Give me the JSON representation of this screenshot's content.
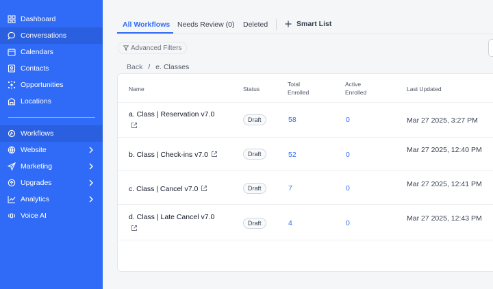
{
  "sidebar": {
    "top_items": [
      {
        "label": "Dashboard",
        "icon": "dashboard-icon"
      },
      {
        "label": "Conversations",
        "icon": "chat-icon"
      },
      {
        "label": "Calendars",
        "icon": "calendar-icon"
      },
      {
        "label": "Contacts",
        "icon": "contacts-icon"
      },
      {
        "label": "Opportunities",
        "icon": "opportunities-icon"
      },
      {
        "label": "Locations",
        "icon": "building-icon"
      }
    ],
    "bottom_items": [
      {
        "label": "Workflows",
        "icon": "workflow-icon"
      },
      {
        "label": "Website",
        "icon": "globe-icon"
      },
      {
        "label": "Marketing",
        "icon": "send-icon"
      },
      {
        "label": "Upgrades",
        "icon": "upgrade-icon"
      },
      {
        "label": "Analytics",
        "icon": "chart-icon"
      },
      {
        "label": "Voice AI",
        "icon": "voice-icon"
      }
    ]
  },
  "tabs": {
    "all": "All Workflows",
    "review": "Needs Review (0)",
    "deleted": "Deleted",
    "smart_list": "Smart List"
  },
  "filters": {
    "label": "Advanced Filters"
  },
  "breadcrumb": {
    "back": "Back",
    "separator": "/",
    "current": "e. Classes"
  },
  "table": {
    "headers": {
      "name": "Name",
      "status": "Status",
      "total_1": "Total",
      "total_2": "Enrolled",
      "active_1": "Active",
      "active_2": "Enrolled",
      "updated": "Last Updated"
    },
    "rows": [
      {
        "name": "a. Class | Reservation v7.0",
        "status": "Draft",
        "total": "58",
        "active": "0",
        "updated": "Mar 27 2025, 3:27 PM"
      },
      {
        "name": "b. Class | Check-ins v7.0",
        "status": "Draft",
        "total": "52",
        "active": "0",
        "updated": "Mar 27 2025, 12:40 PM"
      },
      {
        "name": "c. Class | Cancel v7.0",
        "status": "Draft",
        "total": "7",
        "active": "0",
        "updated": "Mar 27 2025, 12:41 PM"
      },
      {
        "name": "d. Class | Late Cancel v7.0",
        "status": "Draft",
        "total": "4",
        "active": "0",
        "updated": "Mar 27 2025, 12:43 PM"
      }
    ]
  },
  "colors": {
    "accent": "#2f6bf6",
    "sidebar": "#2f6bf6"
  }
}
